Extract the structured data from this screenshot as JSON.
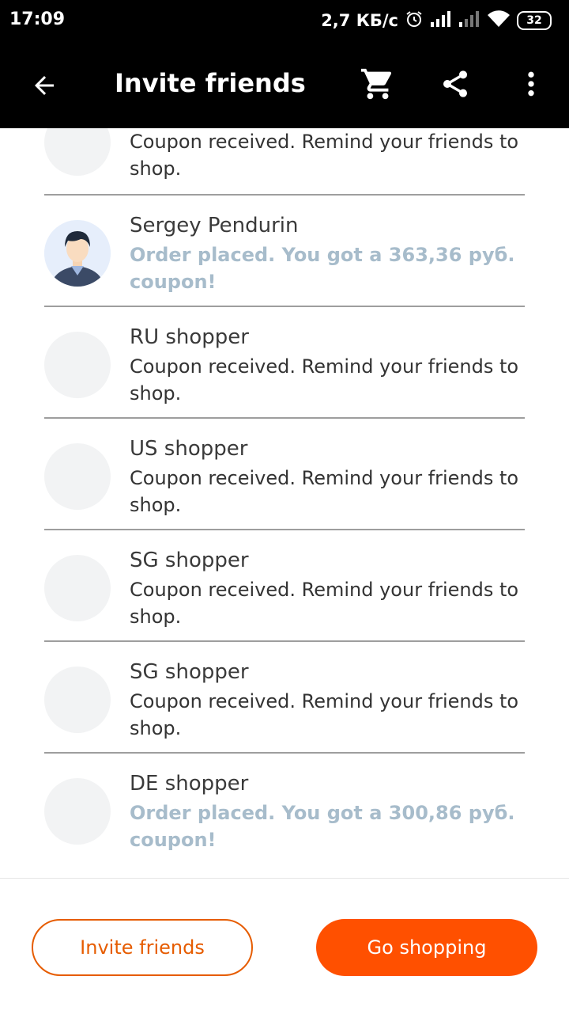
{
  "status_bar": {
    "time": "17:09",
    "network_speed": "2,7 КБ/с",
    "battery": "32"
  },
  "app_bar": {
    "title": "Invite friends",
    "icons": [
      "back-arrow-icon",
      "cart-icon",
      "share-icon",
      "more-vert-icon"
    ]
  },
  "friends": [
    {
      "name": "",
      "status": "Coupon received. Remind your friends to shop.",
      "state": "received",
      "avatar": "placeholder"
    },
    {
      "name": "Sergey Pendurin",
      "status": "Order placed. You got a 363,36 руб. coupon!",
      "state": "placed",
      "avatar": "photo"
    },
    {
      "name": "RU shopper",
      "status": "Coupon received. Remind your friends to shop.",
      "state": "received",
      "avatar": "placeholder"
    },
    {
      "name": "US shopper",
      "status": "Coupon received. Remind your friends to shop.",
      "state": "received",
      "avatar": "placeholder"
    },
    {
      "name": "SG shopper",
      "status": "Coupon received. Remind your friends to shop.",
      "state": "received",
      "avatar": "placeholder"
    },
    {
      "name": "SG shopper",
      "status": "Coupon received. Remind your friends to shop.",
      "state": "received",
      "avatar": "placeholder"
    },
    {
      "name": "DE shopper",
      "status": "Order placed. You got a 300,86 руб. coupon!",
      "state": "placed",
      "avatar": "placeholder"
    }
  ],
  "bottom_bar": {
    "invite_label": "Invite friends",
    "shop_label": "Go shopping"
  },
  "colors": {
    "accent": "#ff5000",
    "placed_text": "#a7bccb",
    "divider": "#9e9e9e"
  }
}
